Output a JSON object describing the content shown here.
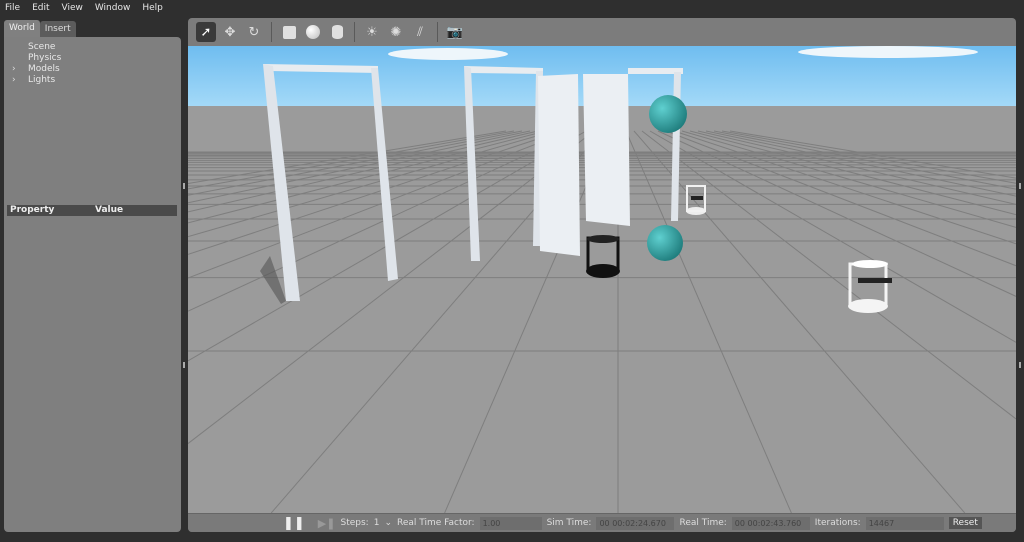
{
  "menu": [
    "File",
    "Edit",
    "View",
    "Window",
    "Help"
  ],
  "tabs": {
    "world": "World",
    "insert": "Insert"
  },
  "tree": [
    {
      "label": "Scene",
      "expandable": false
    },
    {
      "label": "Physics",
      "expandable": false
    },
    {
      "label": "Models",
      "expandable": true
    },
    {
      "label": "Lights",
      "expandable": true
    }
  ],
  "properties": {
    "col1": "Property",
    "col2": "Value"
  },
  "toolbar": [
    "select-arrow-icon",
    "translate-icon",
    "rotate-icon",
    "box-icon",
    "sphere-icon",
    "cylinder-icon",
    "point-light-icon",
    "spot-light-icon",
    "directional-light-icon",
    "screenshot-icon"
  ],
  "bottom": {
    "steps_label": "Steps:",
    "steps_value": "1",
    "rtf_label": "Real Time Factor:",
    "rtf_value": "1.00",
    "sim_label": "Sim Time:",
    "sim_value": "00 00:02:24.670",
    "real_label": "Real Time:",
    "real_value": "00 00:02:43.760",
    "iter_label": "Iterations:",
    "iter_value": "14467",
    "reset": "Reset"
  },
  "colors": {
    "sky": "#8ccdf5",
    "ground": "#9b9b9b",
    "sphere": "#3fa6a6"
  }
}
